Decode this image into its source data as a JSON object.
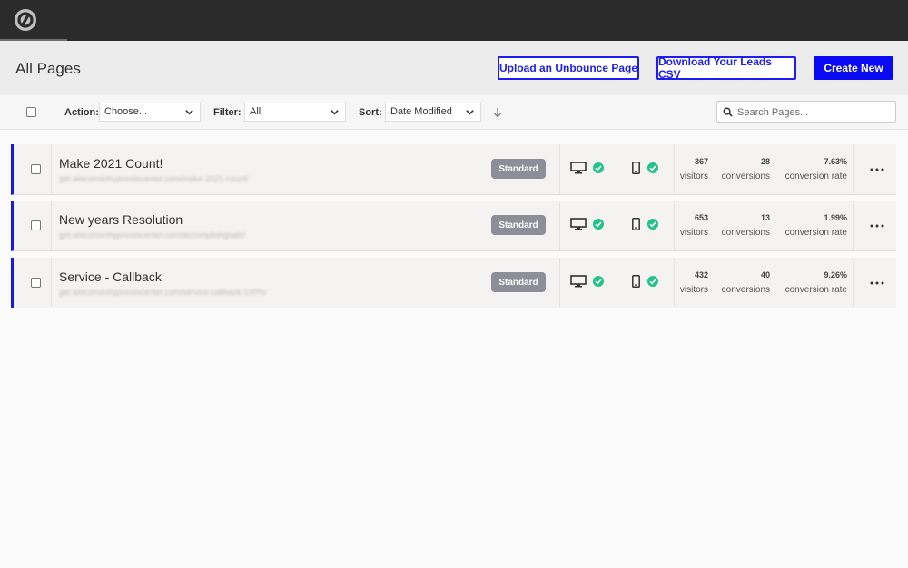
{
  "header": {
    "title": "All Pages",
    "upload_label": "Upload an Unbounce Page",
    "download_label": "Download Your Leads CSV",
    "create_label": "Create New"
  },
  "toolbar": {
    "action_label": "Action:",
    "action_value": "Choose...",
    "filter_label": "Filter:",
    "filter_value": "All",
    "sort_label": "Sort:",
    "sort_value": "Date Modified",
    "search_placeholder": "Search Pages..."
  },
  "colors": {
    "accent": "#0a0af5",
    "row_border": "#1a1ae6",
    "check_green": "#22c28a",
    "badge": "#8c8f97"
  },
  "icons": {
    "logo": "unbounce-logo",
    "desktop": "desktop-icon",
    "mobile": "mobile-icon",
    "check": "check-circle-icon",
    "sort_direction": "arrow-down-icon",
    "search": "search-icon",
    "more": "more-dots-icon"
  },
  "pages": [
    {
      "title": "Make 2021 Count!",
      "url": "get.wisconsinhypnosiscenter.com/make-2021-count/",
      "badge": "Standard",
      "visitors": "367",
      "visitors_label": "visitors",
      "conversions": "28",
      "conversions_label": "conversions",
      "rate": "7.63%",
      "rate_label": "conversion rate"
    },
    {
      "title": "New years Resolution",
      "url": "get.wisconsinhypnosiscenter.com/accomplishgoals/",
      "badge": "Standard",
      "visitors": "653",
      "visitors_label": "visitors",
      "conversions": "13",
      "conversions_label": "conversions",
      "rate": "1.99%",
      "rate_label": "conversion rate"
    },
    {
      "title": "Service - Callback",
      "url": "get.wisconsinhypnosiscenter.com/service-callback-100%/",
      "badge": "Standard",
      "visitors": "432",
      "visitors_label": "visitors",
      "conversions": "40",
      "conversions_label": "conversions",
      "rate": "9.26%",
      "rate_label": "conversion rate"
    }
  ]
}
